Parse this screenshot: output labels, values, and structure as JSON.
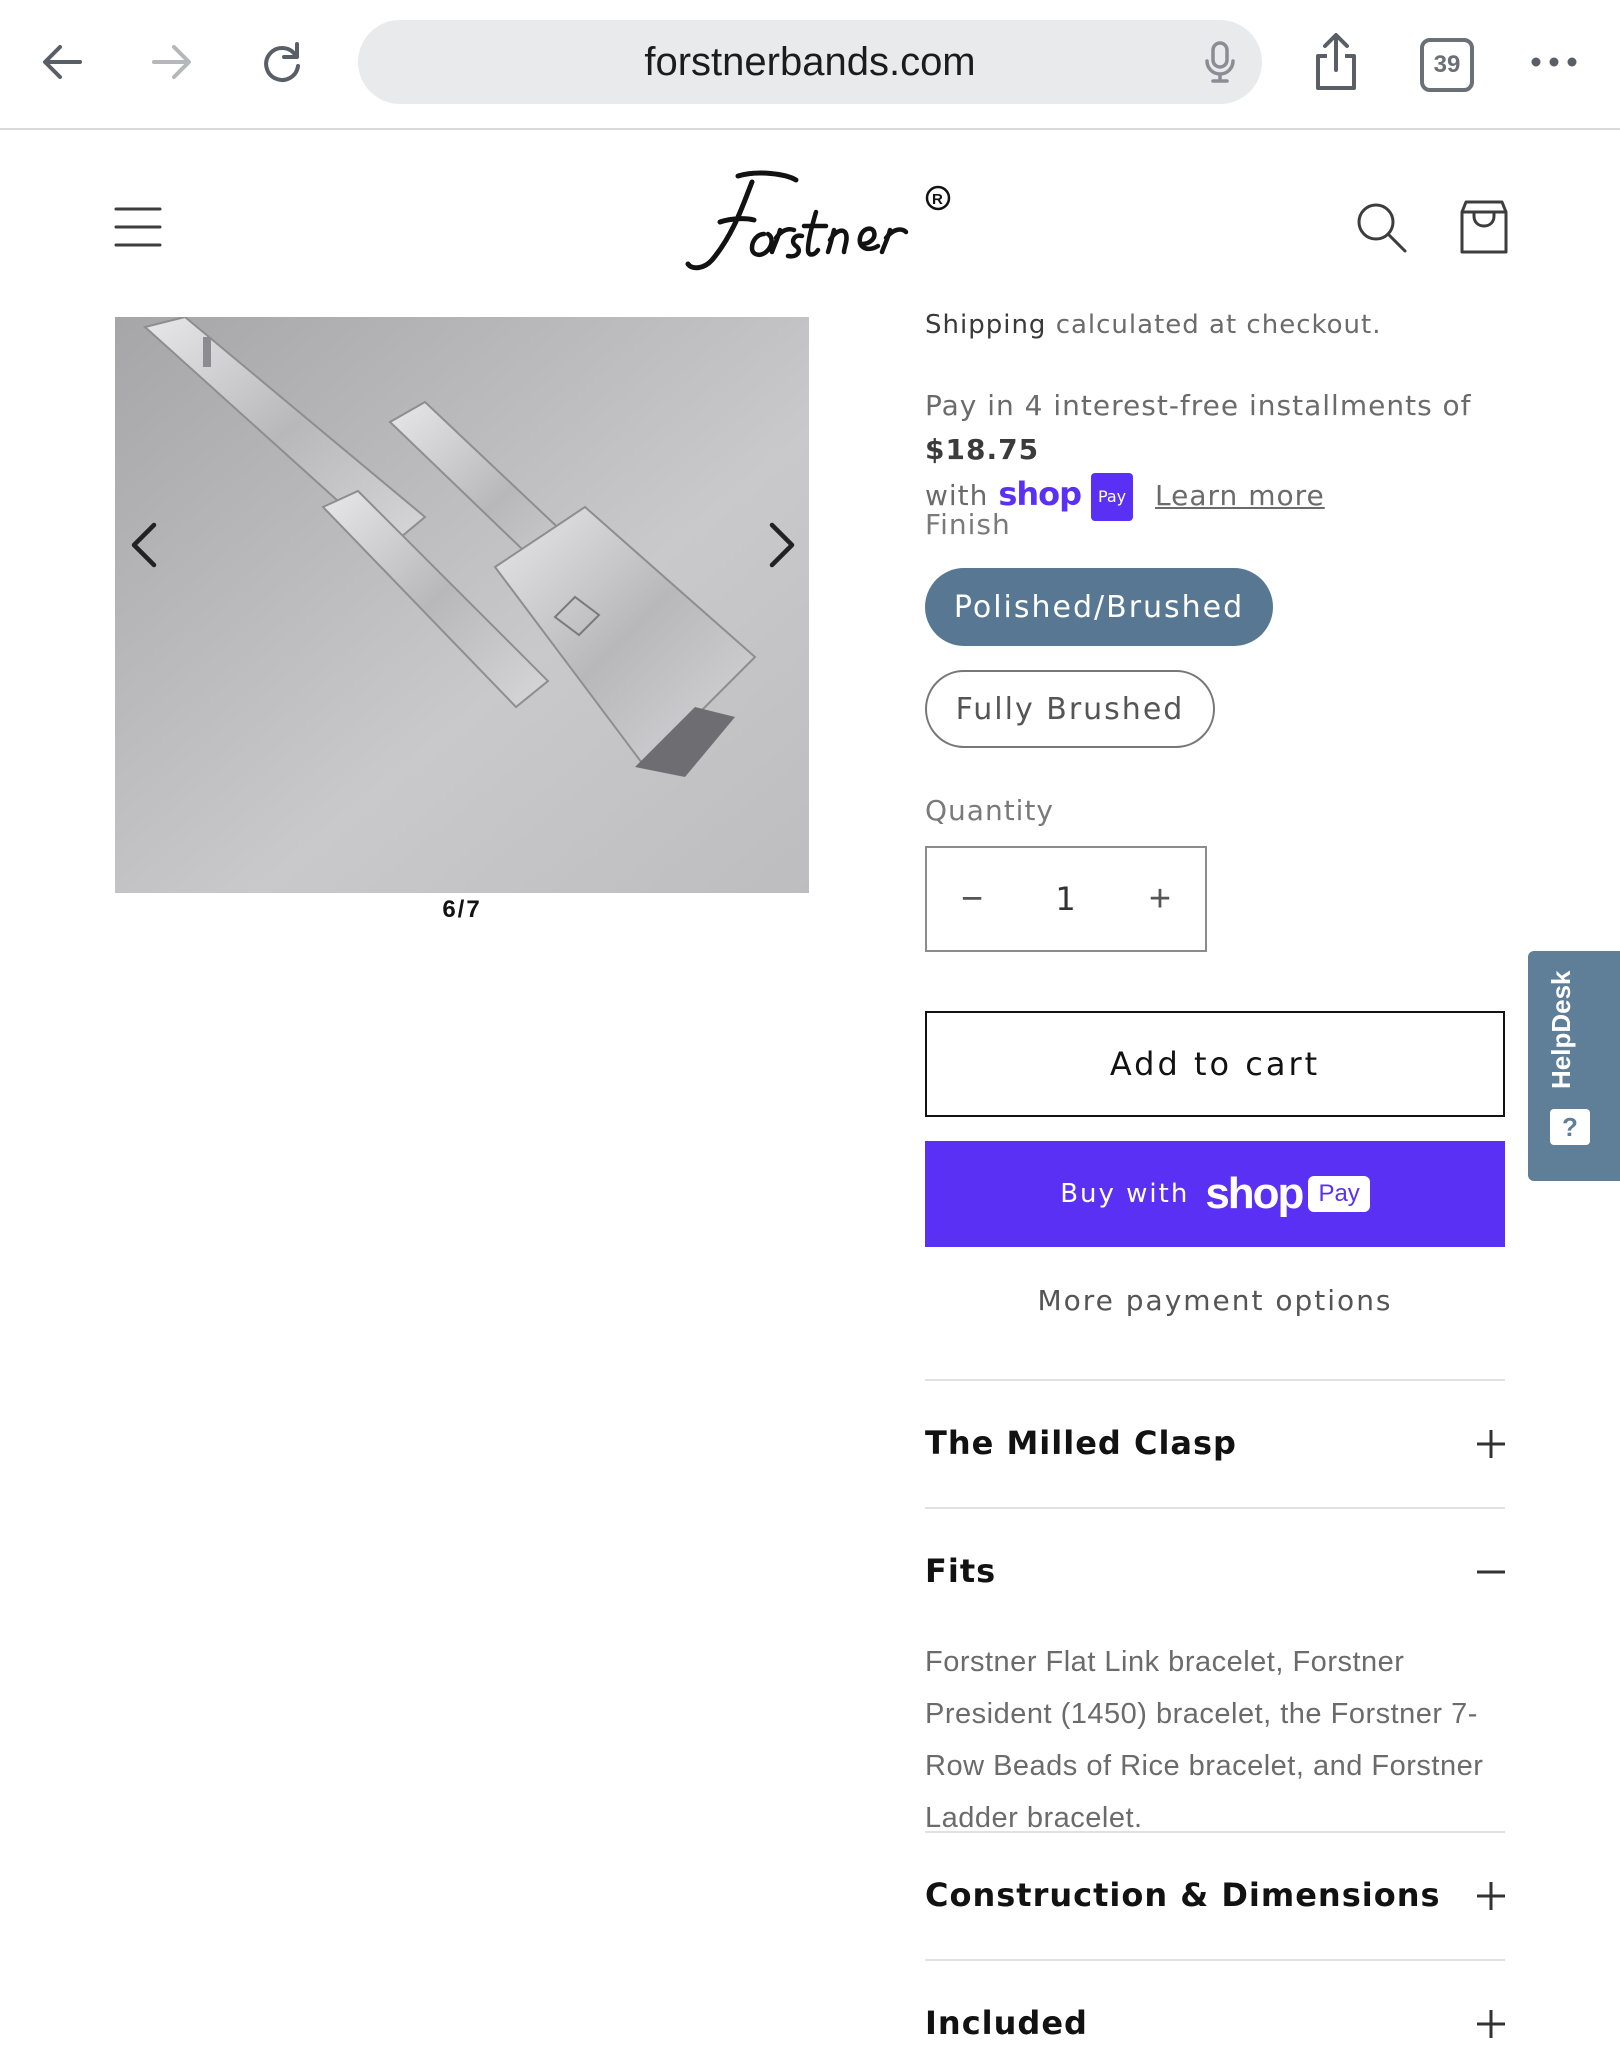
{
  "browser": {
    "url": "forstnerbands.com",
    "tab_count": "39"
  },
  "site": {
    "logo_text": "Forstner",
    "logo_mark": "®"
  },
  "gallery": {
    "counter": "6/7"
  },
  "product": {
    "shipping_link": "Shipping",
    "shipping_rest": "calculated at checkout.",
    "installments_prefix": "Pay in 4 interest-free installments of",
    "installments_amount": "$18.75",
    "installments_with": "with",
    "shop_word": "shop",
    "pay_badge": "Pay",
    "learn_more": "Learn more",
    "finish_label": "Finish",
    "finish_options": [
      "Polished/Brushed",
      "Fully Brushed"
    ],
    "quantity_label": "Quantity",
    "quantity_value": "1",
    "qty_minus": "−",
    "qty_plus": "+",
    "add_to_cart": "Add to cart",
    "buy_with": "Buy with",
    "buy_shop": "shop",
    "buy_pay": "Pay",
    "more_payment": "More payment options"
  },
  "accordion": [
    {
      "title": "The Milled Clasp",
      "state": "collapsed"
    },
    {
      "title": "Fits",
      "state": "expanded",
      "body": "Forstner Flat Link bracelet, Forstner President (1450) bracelet, the Forstner 7-Row Beads of Rice bracelet, and Forstner Ladder bracelet."
    },
    {
      "title": "Construction & Dimensions",
      "state": "collapsed"
    },
    {
      "title": "Included",
      "state": "collapsed"
    }
  ],
  "helpdesk": {
    "label": "HelpDesk",
    "icon": "?"
  },
  "colors": {
    "selected_pill": "#577793",
    "shop_pay": "#5a31f4",
    "helpdesk": "#5f7f98"
  }
}
